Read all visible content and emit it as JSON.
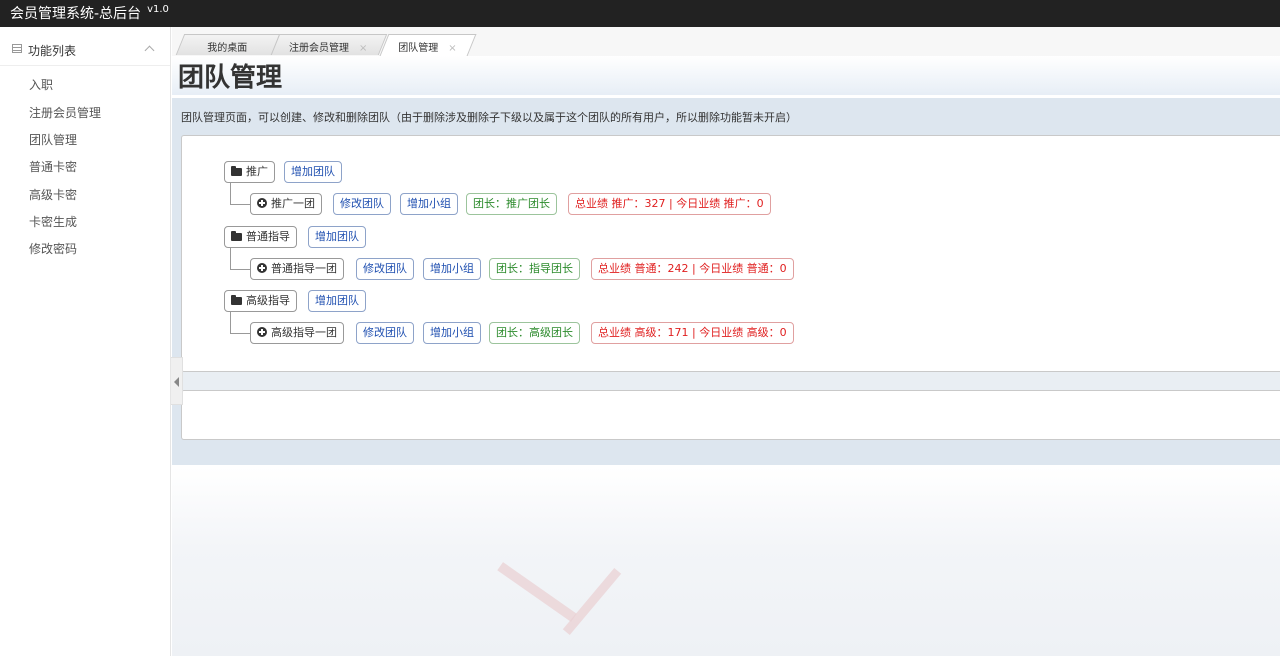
{
  "app": {
    "title": "会员管理系统-总后台",
    "version": "v1.0"
  },
  "sidebar": {
    "title": "功能列表",
    "items": [
      {
        "label": "入职"
      },
      {
        "label": "注册会员管理"
      },
      {
        "label": "团队管理"
      },
      {
        "label": "普通卡密"
      },
      {
        "label": "高级卡密"
      },
      {
        "label": "卡密生成"
      },
      {
        "label": "修改密码"
      }
    ]
  },
  "tabs": [
    {
      "label": "我的桌面",
      "closable": false
    },
    {
      "label": "注册会员管理",
      "closable": true,
      "close": "×"
    },
    {
      "label": "团队管理",
      "closable": true,
      "close": "×",
      "active": true
    }
  ],
  "page": {
    "title": "团队管理",
    "description": "团队管理页面，可以创建、修改和删除团队（由于删除涉及删除子下级以及属于这个团队的所有用户，所以删除功能暂未开启）"
  },
  "tree": [
    {
      "name": "推广",
      "add_label": "增加团队",
      "child": {
        "name": "推广一团",
        "edit_label": "修改团队",
        "add_group_label": "增加小组",
        "leader": "团长：推广团长",
        "stats": "总业绩 推广：327 | 今日业绩 推广：0"
      }
    },
    {
      "name": "普通指导",
      "add_label": "增加团队",
      "child": {
        "name": "普通指导一团",
        "edit_label": "修改团队",
        "add_group_label": "增加小组",
        "leader": "团长：指导团长",
        "stats": "总业绩 普通：242 | 今日业绩 普通：0"
      }
    },
    {
      "name": "高级指导",
      "add_label": "增加团队",
      "child": {
        "name": "高级指导一团",
        "edit_label": "修改团队",
        "add_group_label": "增加小组",
        "leader": "团长：高级团长",
        "stats": "总业绩 高级：171 | 今日业绩 高级：0"
      }
    }
  ],
  "colors": {
    "topbar": "#222222",
    "blue_action": "#1f4fb0",
    "green_leader": "#2b8a2b",
    "red_stats": "#e02020",
    "panel": "#dde6ef"
  }
}
